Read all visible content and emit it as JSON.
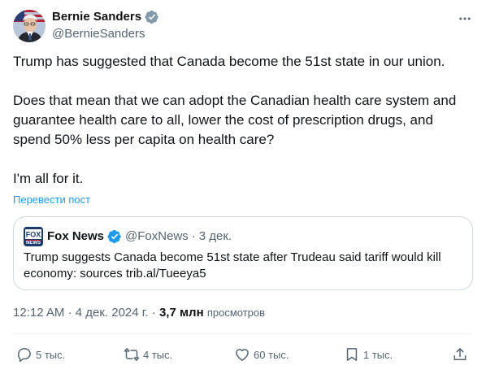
{
  "author": {
    "display_name": "Bernie Sanders",
    "handle": "@BernieSanders",
    "verified": true
  },
  "post": {
    "paragraphs": [
      "Trump has suggested that Canada become the 51st state in our union.",
      "Does that mean that we can adopt the Canadian health care system and guarantee health care to all, lower the cost of prescription drugs, and spend 50% less per capita on health care?",
      "I'm all for it."
    ],
    "translate_label": "Перевести пост"
  },
  "quote": {
    "display_name": "Fox News",
    "handle": "@FoxNews",
    "separator": "·",
    "date": "3 дек.",
    "text": "Trump suggests Canada become 51st state after Trudeau said tariff would kill economy: sources trib.al/Tueeya5",
    "logo_text": "FOX NEWS"
  },
  "meta": {
    "time": "12:12 AM",
    "separator": "·",
    "date": "4 дек. 2024 г.",
    "views_count": "3,7 млн",
    "views_label": "просмотров"
  },
  "actions": {
    "replies": "5 тыс.",
    "reposts": "4 тыс.",
    "likes": "60 тыс.",
    "bookmarks": "1 тыс."
  },
  "colors": {
    "text_primary": "#0f1419",
    "text_secondary": "#536471",
    "link": "#1d9bf0",
    "verified_blue": "#1d9bf0",
    "verified_gray": "#829aab",
    "border": "#cfd9de"
  },
  "icons": {
    "more": "more-horizontal-icon",
    "verified": "verified-badge-icon",
    "reply": "reply-icon",
    "repost": "repost-icon",
    "like": "heart-icon",
    "bookmark": "bookmark-icon",
    "share": "share-icon"
  }
}
